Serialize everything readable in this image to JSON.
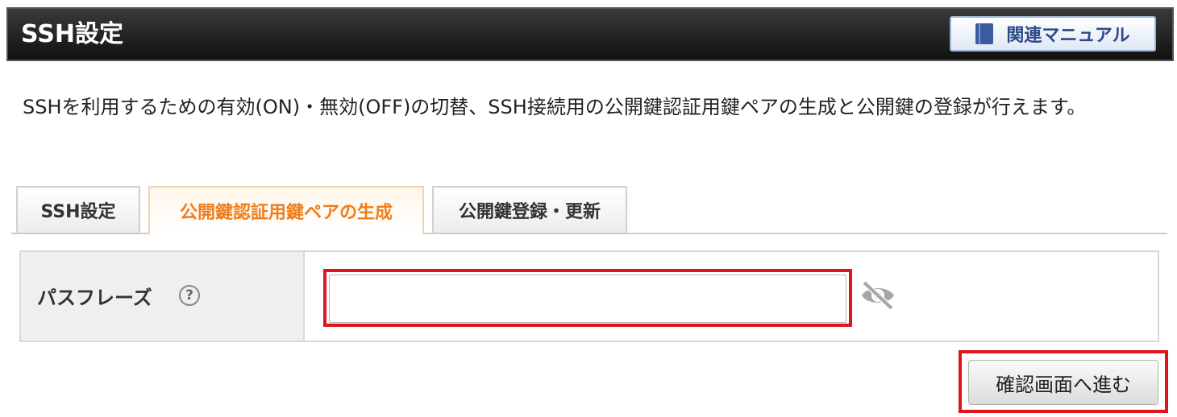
{
  "header": {
    "title": "SSH設定",
    "manual_button": {
      "label": "関連マニュアル",
      "icon": "book-icon"
    }
  },
  "description": "SSHを利用するための有効(ON)・無効(OFF)の切替、SSH接続用の公開鍵認証用鍵ペアの生成と公開鍵の登録が行えます。",
  "tabs": [
    {
      "label": "SSH設定",
      "active": false
    },
    {
      "label": "公開鍵認証用鍵ペアの生成",
      "active": true
    },
    {
      "label": "公開鍵登録・更新",
      "active": false
    }
  ],
  "form": {
    "passphrase_label": "パスフレーズ",
    "help_icon": "?",
    "passphrase_value": "",
    "passphrase_placeholder": "",
    "visibility_icon": "eye-slash-icon"
  },
  "submit_label": "確認画面へ進む",
  "colors": {
    "header_bg": "#111111",
    "active_tab": "#f07d1a",
    "highlight": "#e1141e",
    "manual_text": "#2d4a8a"
  }
}
